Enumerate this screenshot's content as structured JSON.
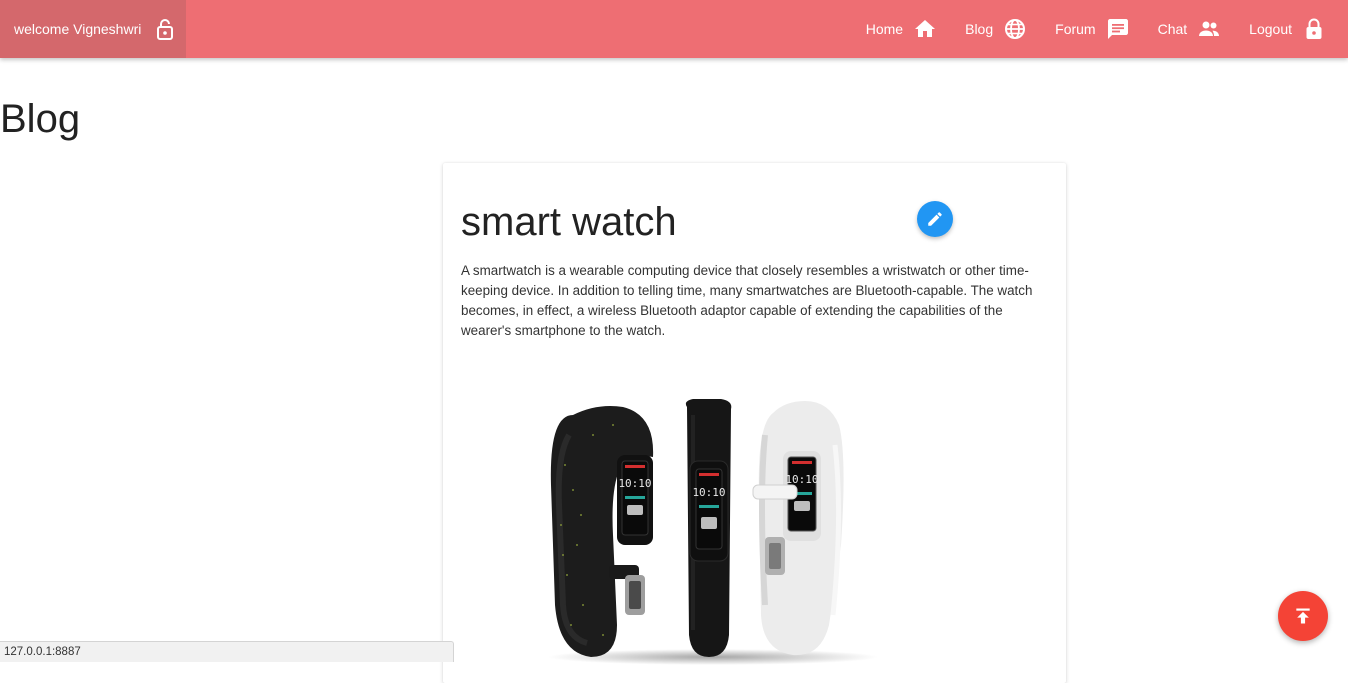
{
  "navbar": {
    "brand": {
      "text": "welcome Vigneshwri",
      "icon": "lock-open-icon"
    },
    "items": [
      {
        "label": "Home",
        "icon": "home-icon"
      },
      {
        "label": "Blog",
        "icon": "globe-icon"
      },
      {
        "label": "Forum",
        "icon": "message-icon"
      },
      {
        "label": "Chat",
        "icon": "people-icon"
      },
      {
        "label": "Logout",
        "icon": "lock-icon"
      }
    ],
    "color": "#ee6e73"
  },
  "page": {
    "title": "Blog"
  },
  "post": {
    "title": "smart watch",
    "body": "A smartwatch is a wearable computing device that closely resembles a wristwatch or other time-keeping device. In addition to telling time, many smartwatches are Bluetooth-capable. The watch becomes, in effect, a wireless Bluetooth adaptor capable of extending the capabilities of the wearer's smartphone to the watch.",
    "edit_icon": "pencil-icon",
    "edit_color": "#2196f3",
    "image_watch_time": "10:10"
  },
  "fab": {
    "icon": "scroll-to-top-icon",
    "color": "#f44336"
  },
  "status_bar": {
    "url": "127.0.0.1:8887"
  }
}
